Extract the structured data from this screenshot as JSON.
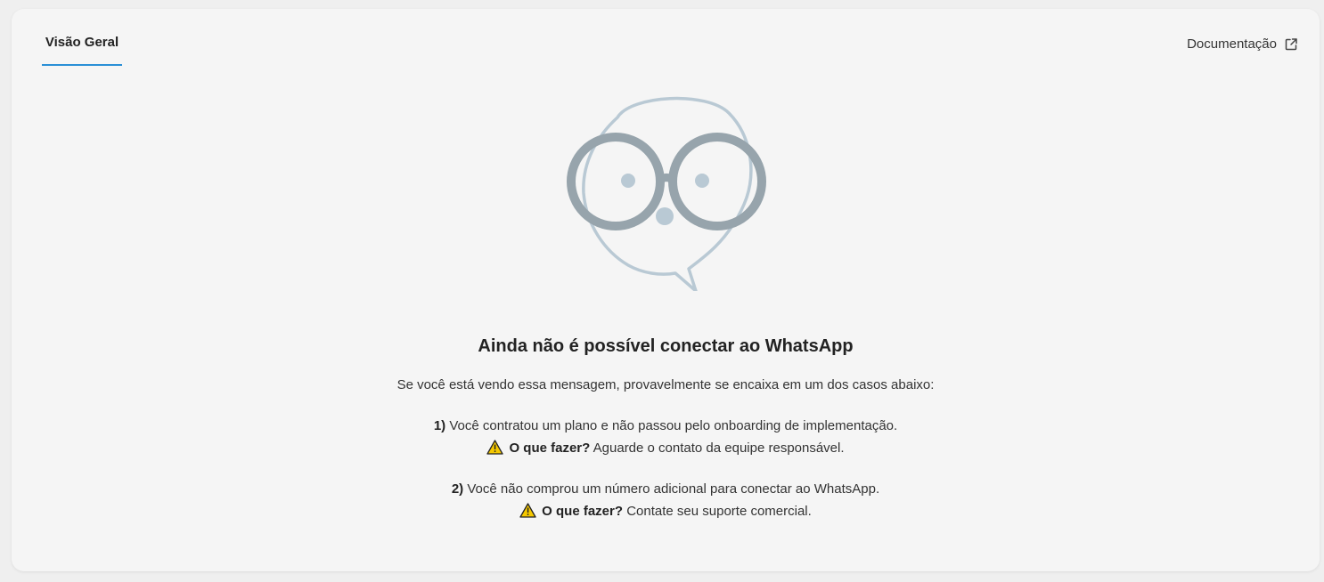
{
  "tabs": [
    {
      "label": "Visão Geral",
      "active": true
    }
  ],
  "header": {
    "doc_link_label": "Documentação",
    "doc_link_icon": "external-link-icon"
  },
  "illustration": {
    "icon": "speech-bubble-glasses-icon",
    "colors": {
      "bubble": "#b9c9d4",
      "glasses": "#97a4ac",
      "dots": "#b9c9d4"
    }
  },
  "empty_state": {
    "title": "Ainda não é possível conectar ao WhatsApp",
    "intro": "Se você está vendo essa mensagem, provavelmente se encaixa em um dos casos abaixo:",
    "cases": [
      {
        "number": "1)",
        "text": "Você contratou um plano e não passou pelo onboarding de implementação.",
        "action_icon": "warning-icon",
        "action_label": "O que fazer?",
        "action_text": "Aguarde o contato da equipe responsável."
      },
      {
        "number": "2)",
        "text": "Você não comprou um número adicional para conectar ao WhatsApp.",
        "action_icon": "warning-icon",
        "action_label": "O que fazer?",
        "action_text": "Contate seu suporte comercial."
      }
    ]
  },
  "colors": {
    "accent": "#2a8fd6",
    "warning": "#f5c800"
  }
}
